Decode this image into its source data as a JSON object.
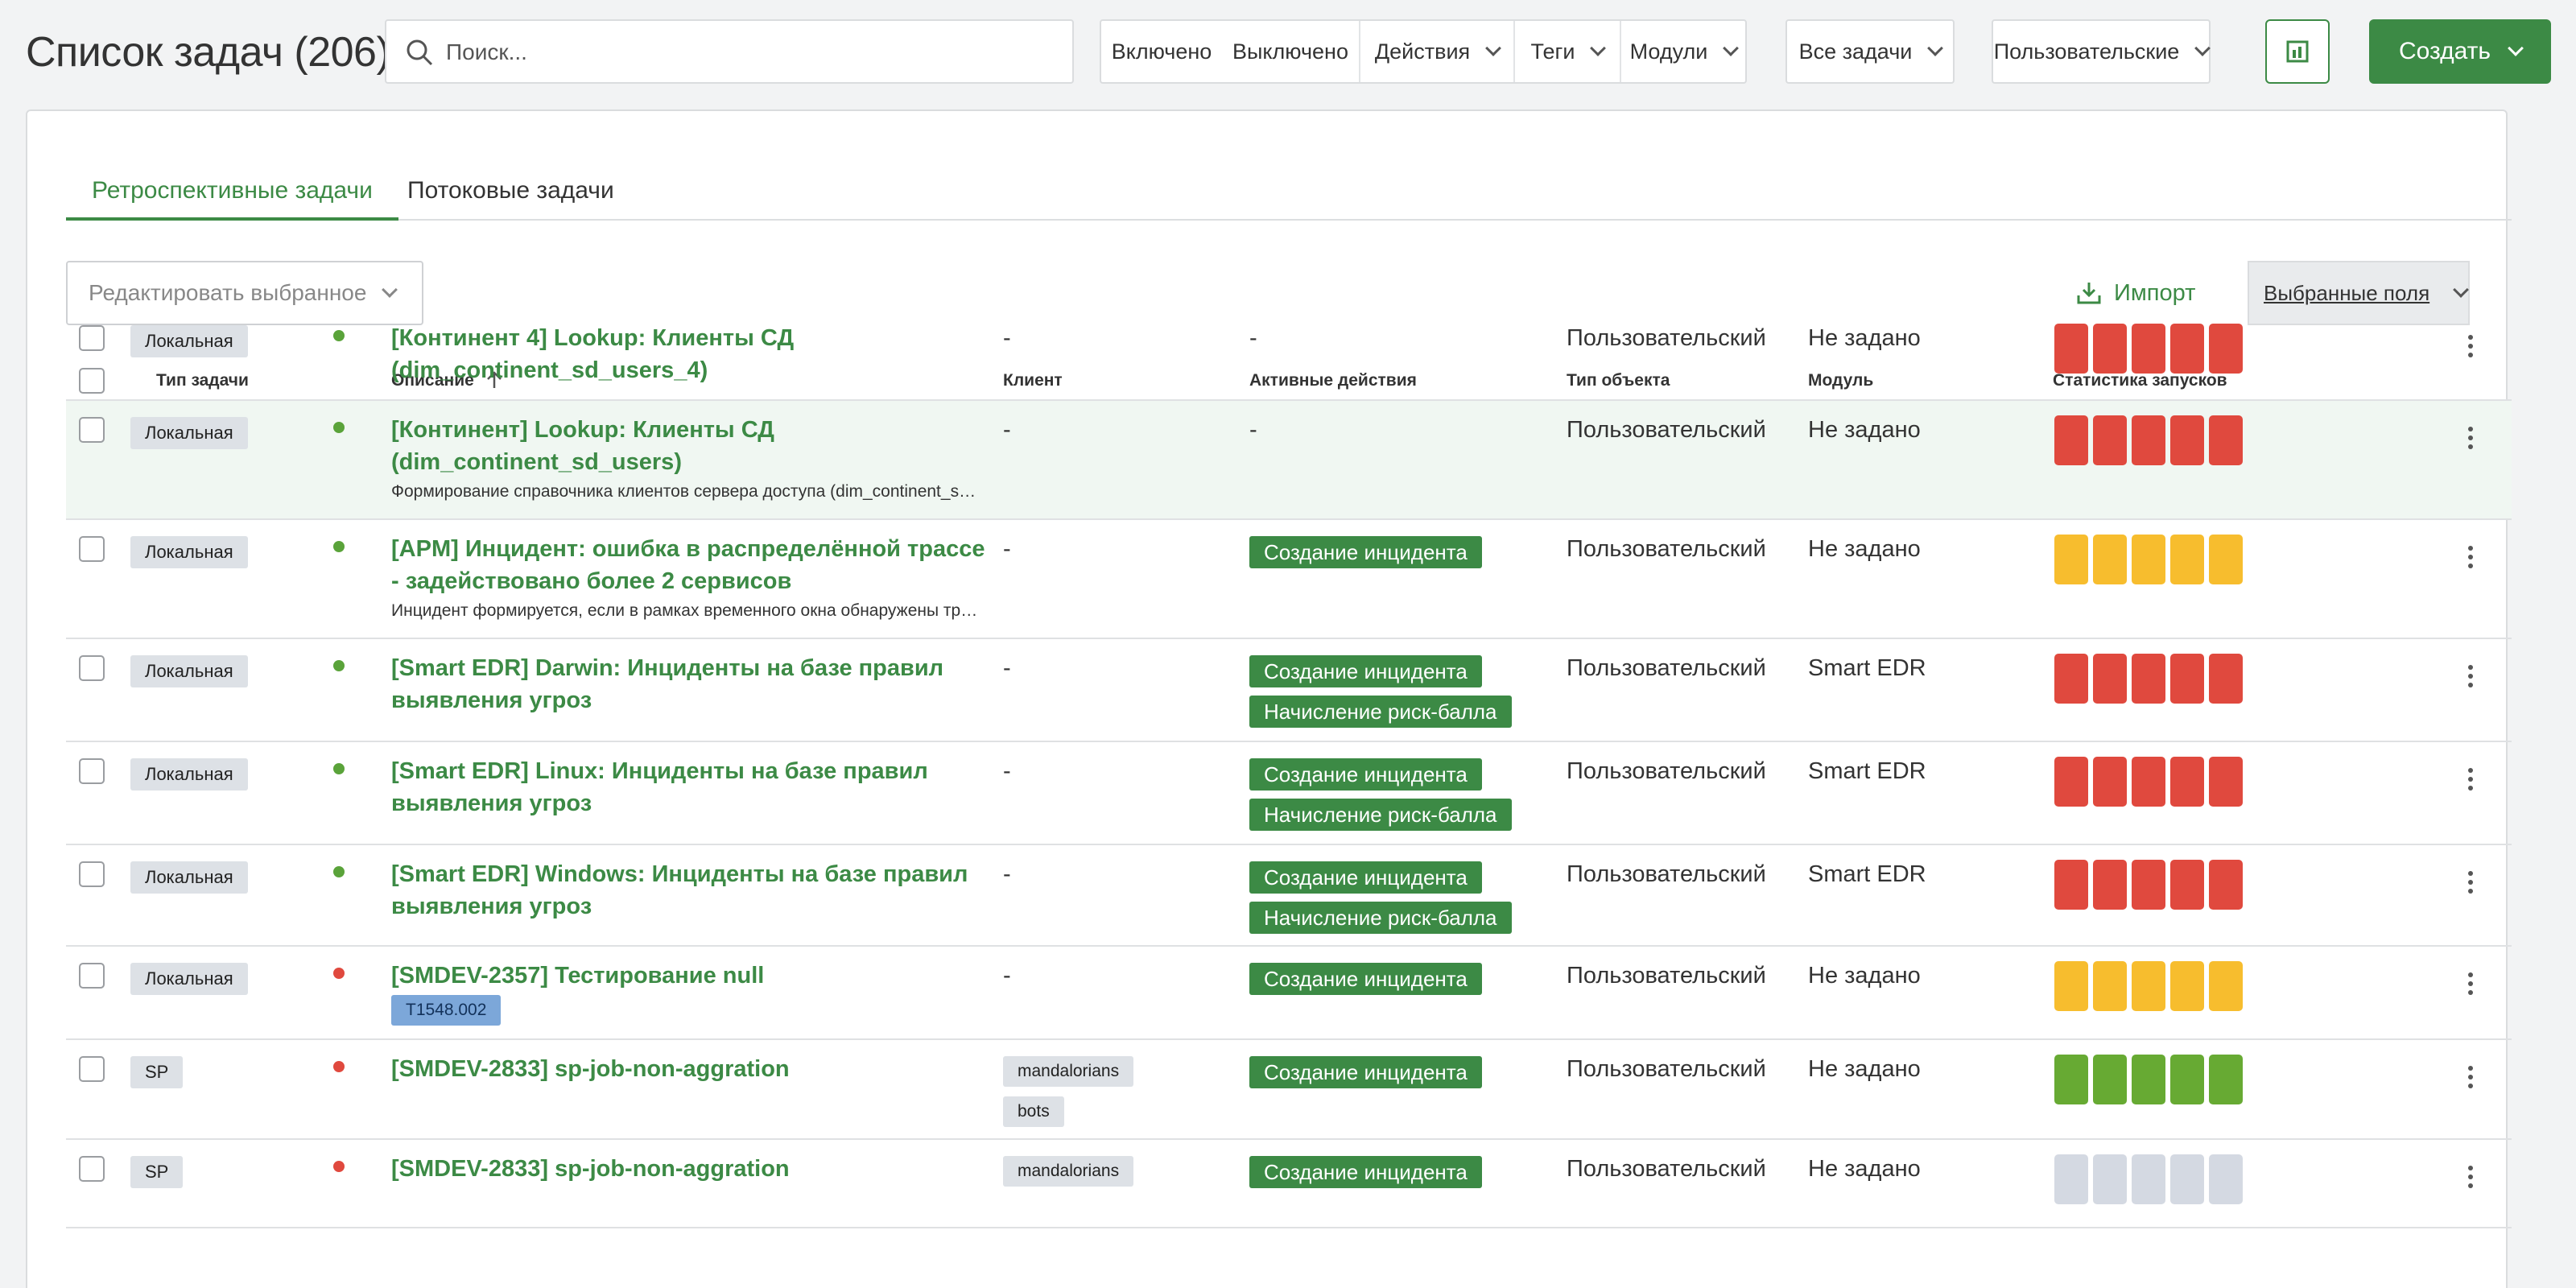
{
  "header": {
    "title": "Список задач (206)",
    "search_placeholder": "Поиск...",
    "filters": [
      "Включено",
      "Выключено",
      "Действия",
      "Теги",
      "Модули"
    ],
    "all_tasks": "Все задачи",
    "custom": "Пользовательские",
    "stats_icon": "chart-icon",
    "create_label": "Создать"
  },
  "tabs": [
    {
      "label": "Ретроспективные задачи",
      "active": true
    },
    {
      "label": "Потоковые задачи",
      "active": false
    }
  ],
  "toolbar": {
    "edit_selected": "Редактировать выбранное",
    "import_label": "Импорт",
    "fields_label": "Выбранные поля"
  },
  "columns": [
    "Тип задачи",
    "Описание",
    "Клиент",
    "Активные действия",
    "Тип объекта",
    "Модуль",
    "Статистика запусков"
  ],
  "sort_icon": "arrow-up-icon",
  "colors": {
    "accent": "#3c8a45",
    "red": "#e0493e",
    "yellow": "#f7bd2e",
    "green": "#67aa33",
    "gray": "#d4d9e2",
    "dot_green": "#5aa33a",
    "dot_red": "#e0493e"
  },
  "rows": [
    {
      "type": "Локальная",
      "status": "green",
      "title": "[Континент 4] Lookup: Клиенты СД (dim_continent_sd_users_4)",
      "subtitle": "",
      "tag": "",
      "client": "-",
      "client_tags": [],
      "actions_text": "-",
      "actions": [],
      "object_type": "Пользовательский",
      "module": "Не задано",
      "stats": [
        "red",
        "red",
        "red",
        "red",
        "red"
      ]
    },
    {
      "type": "Локальная",
      "status": "green",
      "title": "[Континент] Lookup: Клиенты СД (dim_continent_sd_users)",
      "subtitle": "Формирование справочника клиентов сервера доступа (dim_continent_sd_users)",
      "tag": "",
      "client": "-",
      "client_tags": [],
      "actions_text": "-",
      "actions": [],
      "object_type": "Пользовательский",
      "module": "Не задано",
      "stats": [
        "red",
        "red",
        "red",
        "red",
        "red"
      ]
    },
    {
      "type": "Локальная",
      "status": "green",
      "title": "[APM] Инцидент: ошибка в распределённой трассе - задействовано более 2 сервисов",
      "subtitle": "Инцидент формируется, если в рамках временного окна обнаружены трассы с ошибками",
      "tag": "",
      "client": "-",
      "client_tags": [],
      "actions_text": "",
      "actions": [
        "Создание инцидента"
      ],
      "object_type": "Пользовательский",
      "module": "Не задано",
      "stats": [
        "yellow",
        "yellow",
        "yellow",
        "yellow",
        "yellow"
      ]
    },
    {
      "type": "Локальная",
      "status": "green",
      "title": "[Smart EDR] Darwin: Инциденты на базе правил выявления угроз",
      "subtitle": "",
      "tag": "",
      "client": "-",
      "client_tags": [],
      "actions_text": "",
      "actions": [
        "Создание инцидента",
        "Начисление риск-балла"
      ],
      "object_type": "Пользовательский",
      "module": "Smart EDR",
      "stats": [
        "red",
        "red",
        "red",
        "red",
        "red"
      ]
    },
    {
      "type": "Локальная",
      "status": "green",
      "title": "[Smart EDR] Linux: Инциденты на базе правил выявления угроз",
      "subtitle": "",
      "tag": "",
      "client": "-",
      "client_tags": [],
      "actions_text": "",
      "actions": [
        "Создание инцидента",
        "Начисление риск-балла"
      ],
      "object_type": "Пользовательский",
      "module": "Smart EDR",
      "stats": [
        "red",
        "red",
        "red",
        "red",
        "red"
      ]
    },
    {
      "type": "Локальная",
      "status": "green",
      "title": "[Smart EDR] Windows: Инциденты на базе правил выявления угроз",
      "subtitle": "",
      "tag": "",
      "client": "-",
      "client_tags": [],
      "actions_text": "",
      "actions": [
        "Создание инцидента",
        "Начисление риск-балла"
      ],
      "object_type": "Пользовательский",
      "module": "Smart EDR",
      "stats": [
        "red",
        "red",
        "red",
        "red",
        "red"
      ]
    },
    {
      "type": "Локальная",
      "status": "red",
      "title": "[SMDEV-2357] Тестирование null",
      "subtitle": "",
      "tag": "T1548.002",
      "client": "-",
      "client_tags": [],
      "actions_text": "",
      "actions": [
        "Создание инцидента"
      ],
      "object_type": "Пользовательский",
      "module": "Не задано",
      "stats": [
        "yellow",
        "yellow",
        "yellow",
        "yellow",
        "yellow"
      ]
    },
    {
      "type": "SP",
      "status": "red",
      "title": "[SMDEV-2833] sp-job-non-aggration",
      "subtitle": "",
      "tag": "",
      "client": "",
      "client_tags": [
        "mandalorians",
        "bots"
      ],
      "actions_text": "",
      "actions": [
        "Создание инцидента"
      ],
      "object_type": "Пользовательский",
      "module": "Не задано",
      "stats": [
        "green",
        "green",
        "green",
        "green",
        "green"
      ]
    },
    {
      "type": "SP",
      "status": "red",
      "title": "[SMDEV-2833] sp-job-non-aggration",
      "subtitle": "",
      "tag": "",
      "client": "",
      "client_tags": [
        "mandalorians"
      ],
      "actions_text": "",
      "actions": [
        "Создание инцидента"
      ],
      "object_type": "Пользовательский",
      "module": "Не задано",
      "stats": [
        "gray",
        "gray",
        "gray",
        "gray",
        "gray"
      ]
    }
  ]
}
